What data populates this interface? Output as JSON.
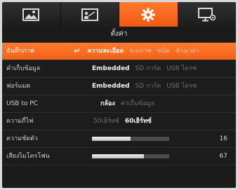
{
  "tabs": [
    {
      "icon": "image-icon",
      "active": false
    },
    {
      "icon": "presentation-icon",
      "active": false
    },
    {
      "icon": "gear-icon",
      "active": true
    },
    {
      "icon": "monitor-icon",
      "active": false
    }
  ],
  "title": "ตั้งค่า",
  "rows": [
    {
      "label": "อันทึกภาพ",
      "selected": true,
      "options": [
        "ความละเอียด",
        "คุณภาพ",
        "ขนิด",
        "ช่วงเวลา"
      ],
      "active_index": 0
    },
    {
      "label": "คำเก็บข้อมูล",
      "options": [
        "Embedded",
        "SD การ์ด",
        "USB ไดรฟ"
      ],
      "active_index": 0
    },
    {
      "label": "ฟอร์แมต",
      "options": [
        "Embedded",
        "SD การ์ด",
        "USB ไดรฟ"
      ],
      "active_index": 0
    },
    {
      "label": "USB to PC",
      "options": [
        "กล้อง",
        "ค่าเก็บข้อมูล"
      ],
      "active_index": 0
    },
    {
      "label": "ความถี่ไฟ",
      "options": [
        "50เฮิร์ทซ์",
        "60เฮิร์ทซ์"
      ],
      "active_index": 1
    },
    {
      "label": "ความชัดตัว",
      "slider_value": "16",
      "slider_fraction": 0.5
    },
    {
      "label": "เสียงไมโครโฟน",
      "slider_value": "67",
      "slider_fraction": 0.67
    }
  ],
  "colors": {
    "accent": "#f26a1b",
    "background": "#1b1b1b"
  }
}
